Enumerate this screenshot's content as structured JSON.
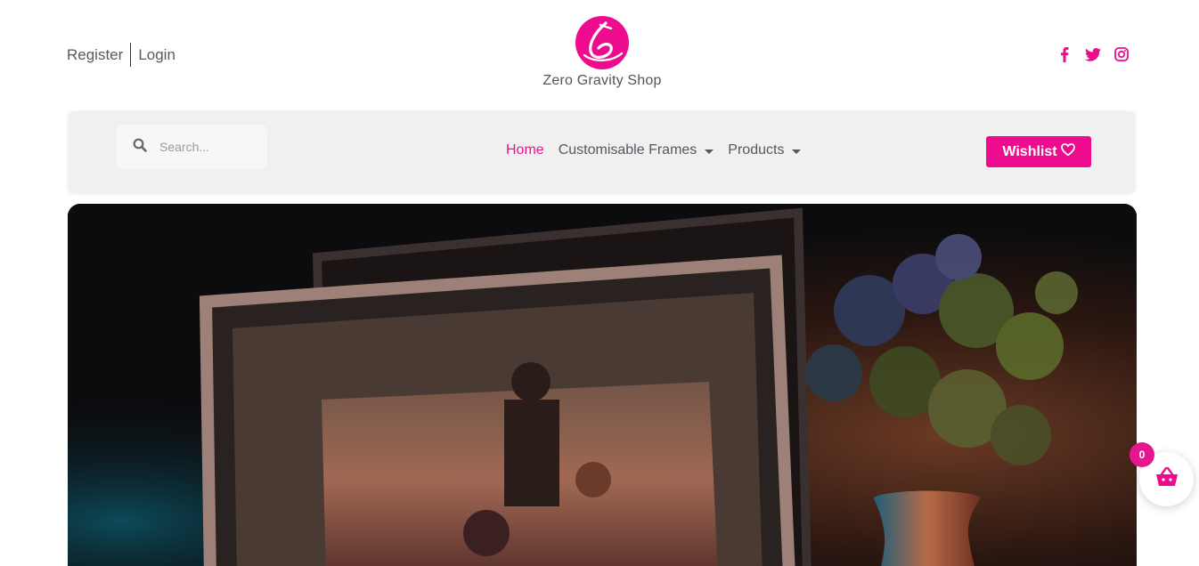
{
  "auth": {
    "register_label": "Register",
    "login_label": "Login"
  },
  "brand": {
    "name": "Zero Gravity Shop"
  },
  "social": {
    "icons": [
      "facebook-icon",
      "twitter-icon",
      "instagram-icon"
    ]
  },
  "search": {
    "placeholder": "Search..."
  },
  "nav": {
    "items": [
      {
        "label": "Home",
        "active": true,
        "has_dropdown": false
      },
      {
        "label": "Customisable Frames",
        "active": false,
        "has_dropdown": true
      },
      {
        "label": "Products",
        "active": false,
        "has_dropdown": true
      }
    ]
  },
  "wishlist": {
    "label": "Wishlist"
  },
  "cart": {
    "count": "0"
  },
  "colors": {
    "accent": "#ee0b8d",
    "nav_bg": "#f0f0f0",
    "text": "#54595f"
  }
}
